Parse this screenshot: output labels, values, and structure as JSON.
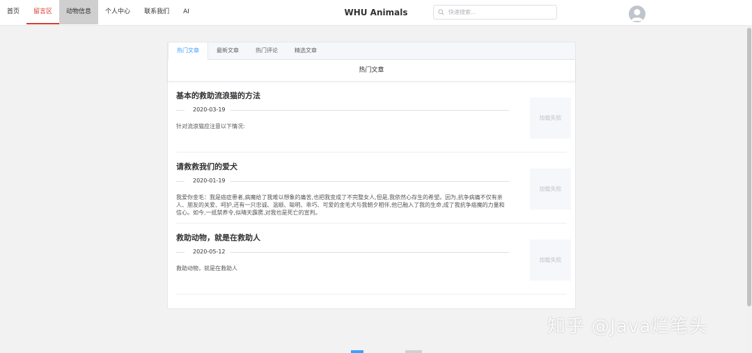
{
  "nav": {
    "items": [
      {
        "label": "首页"
      },
      {
        "label": "留言区"
      },
      {
        "label": "动物信息"
      },
      {
        "label": "个人中心"
      },
      {
        "label": "联系我们"
      },
      {
        "label": "AI"
      }
    ],
    "active_index": 1,
    "hover_index": 2
  },
  "header": {
    "title": "WHU Animals",
    "search_placeholder": "快速搜索..."
  },
  "tabs": [
    {
      "label": "热门文章"
    },
    {
      "label": "最新文章"
    },
    {
      "label": "热门评论"
    },
    {
      "label": "精选文章"
    }
  ],
  "panel": {
    "heading": "热门文章"
  },
  "articles": [
    {
      "title": "基本的救助流浪猫的方法",
      "date": "2020-03-19",
      "excerpt": "针对流浪猫应注意以下情况:",
      "thumb_text": "加载失败"
    },
    {
      "title": "请救救我们的爱犬",
      "date": "2020-01-19",
      "excerpt": "我爱你金毛：我是癌症患者,病魔给了我难以想象的痛苦,也把我变成了不完整女人,但是,我依然心存生的希望。因为,抗争病痛不仅有亲人、朋友的关爱、呵护,还有一只忠诚、温顺、聪明、乖巧、可爱的金毛犬与我朝夕相伴,他已融入了我的生命,成了我抗争癌魔的力量和信心。如今,一纸禁养令,似晴天霹雳,对我也是死亡的宣判。",
      "thumb_text": "加载失败"
    },
    {
      "title": "救助动物，就是在救助人",
      "date": "2020-05-12",
      "excerpt": "救助动物，就是在救助人",
      "thumb_text": "加载失败"
    }
  ],
  "watermark": "知乎 @Java烂笔头",
  "colors": {
    "accent": "#409eff",
    "nav_active": "#d93a2f"
  }
}
